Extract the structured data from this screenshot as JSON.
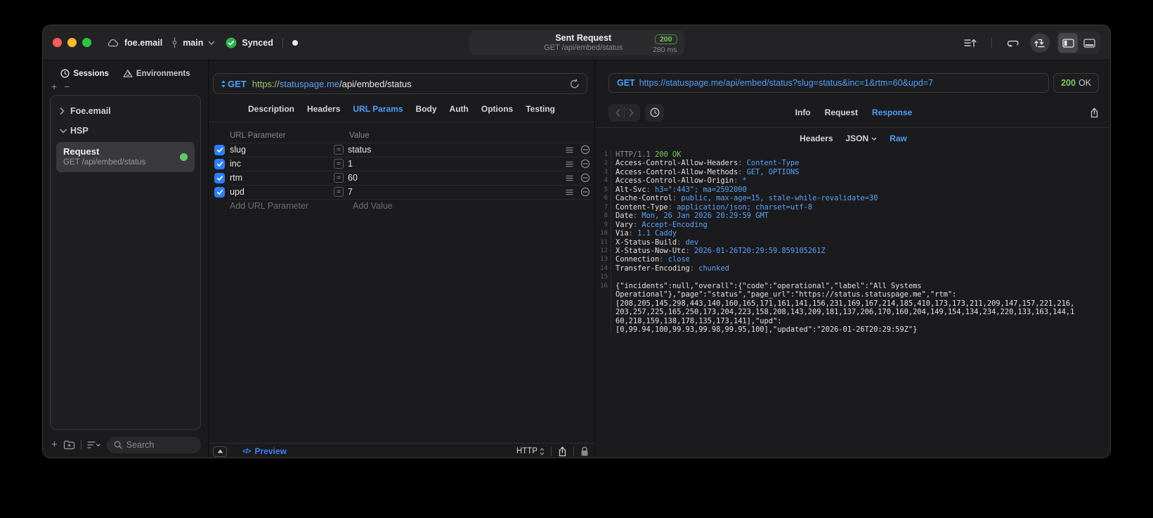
{
  "accents": {
    "blue": "#4f9df8",
    "green": "#7cc761",
    "checkbox_blue": "#2f7df6",
    "synced_green": "#2fb24c"
  },
  "titlebar": {
    "project": "foe.email",
    "branch": "main",
    "sync_status": "Synced",
    "center": {
      "title": "Sent Request",
      "subtitle": "GET /api/embed/status",
      "status_code": "200",
      "duration": "280 ms"
    }
  },
  "sidebar": {
    "tabs": [
      {
        "label": "Sessions"
      },
      {
        "label": "Environments"
      }
    ],
    "tree": [
      {
        "label": "Foe.email"
      },
      {
        "label": "HSP"
      }
    ],
    "request_item": {
      "title": "Request",
      "subtitle": "GET /api/embed/status"
    },
    "search_placeholder": "Search"
  },
  "request_editor": {
    "method": "GET",
    "url": {
      "scheme": "https://",
      "host": "statuspage.me",
      "path": "/api/embed/status"
    },
    "tabs": [
      "Description",
      "Headers",
      "URL Params",
      "Body",
      "Auth",
      "Options",
      "Testing"
    ],
    "active_tab": "URL Params",
    "param_table": {
      "col_param": "URL Parameter",
      "col_value": "Value",
      "rows": [
        {
          "name": "slug",
          "value": "status"
        },
        {
          "name": "inc",
          "value": "1"
        },
        {
          "name": "rtm",
          "value": "60"
        },
        {
          "name": "upd",
          "value": "7"
        }
      ],
      "add_param": "Add URL Parameter",
      "add_value": "Add Value"
    },
    "footer": {
      "preview": "Preview",
      "protocol": "HTTP"
    }
  },
  "response_pane": {
    "method": "GET",
    "url": "https://statuspage.me/api/embed/status?slug=status&inc=1&rtm=60&upd=7",
    "status_code": "200",
    "status_text": "OK",
    "tabs": [
      "Info",
      "Request",
      "Response"
    ],
    "active_tab": "Response",
    "subtabs": [
      "Headers",
      "JSON",
      "Raw"
    ],
    "active_subtab": "Raw",
    "body_lines": [
      {
        "num": "1",
        "segs": [
          {
            "t": "HTTP/1.1 ",
            "c": "d"
          },
          {
            "t": "200 OK",
            "c": "g"
          }
        ]
      },
      {
        "num": "2",
        "segs": [
          {
            "t": "Access-Control-Allow-Headers",
            "c": "n"
          },
          {
            "t": ": ",
            "c": "d"
          },
          {
            "t": "Content-Type",
            "c": "v"
          }
        ]
      },
      {
        "num": "3",
        "segs": [
          {
            "t": "Access-Control-Allow-Methods",
            "c": "n"
          },
          {
            "t": ": ",
            "c": "d"
          },
          {
            "t": "GET, OPTIONS",
            "c": "v"
          }
        ]
      },
      {
        "num": "4",
        "segs": [
          {
            "t": "Access-Control-Allow-Origin",
            "c": "n"
          },
          {
            "t": ": ",
            "c": "d"
          },
          {
            "t": "*",
            "c": "v"
          }
        ]
      },
      {
        "num": "5",
        "segs": [
          {
            "t": "Alt-Svc",
            "c": "n"
          },
          {
            "t": ": ",
            "c": "d"
          },
          {
            "t": "h3=\":443\"; ma=2592000",
            "c": "v"
          }
        ]
      },
      {
        "num": "6",
        "segs": [
          {
            "t": "Cache-Control",
            "c": "n"
          },
          {
            "t": ": ",
            "c": "d"
          },
          {
            "t": "public, max-age=15, stale-while-revalidate=30",
            "c": "v"
          }
        ]
      },
      {
        "num": "7",
        "segs": [
          {
            "t": "Content-Type",
            "c": "n"
          },
          {
            "t": ": ",
            "c": "d"
          },
          {
            "t": "application/json; charset=utf-8",
            "c": "v"
          }
        ]
      },
      {
        "num": "8",
        "segs": [
          {
            "t": "Date",
            "c": "n"
          },
          {
            "t": ": ",
            "c": "d"
          },
          {
            "t": "Mon, 26 Jan 2026 20:29:59 GMT",
            "c": "v"
          }
        ]
      },
      {
        "num": "9",
        "segs": [
          {
            "t": "Vary",
            "c": "n"
          },
          {
            "t": ": ",
            "c": "d"
          },
          {
            "t": "Accept-Encoding",
            "c": "v"
          }
        ]
      },
      {
        "num": "10",
        "segs": [
          {
            "t": "Via",
            "c": "n"
          },
          {
            "t": ": ",
            "c": "d"
          },
          {
            "t": "1.1 Caddy",
            "c": "v"
          }
        ]
      },
      {
        "num": "11",
        "segs": [
          {
            "t": "X-Status-Build",
            "c": "n"
          },
          {
            "t": ": ",
            "c": "d"
          },
          {
            "t": "dev",
            "c": "v"
          }
        ]
      },
      {
        "num": "12",
        "segs": [
          {
            "t": "X-Status-Now-Utc",
            "c": "n"
          },
          {
            "t": ": ",
            "c": "d"
          },
          {
            "t": "2026-01-26T20:29:59.859105261Z",
            "c": "v"
          }
        ]
      },
      {
        "num": "13",
        "segs": [
          {
            "t": "Connection",
            "c": "n"
          },
          {
            "t": ": ",
            "c": "d"
          },
          {
            "t": "close",
            "c": "v"
          }
        ]
      },
      {
        "num": "14",
        "segs": [
          {
            "t": "Transfer-Encoding",
            "c": "n"
          },
          {
            "t": ": ",
            "c": "d"
          },
          {
            "t": "chunked",
            "c": "v"
          }
        ]
      },
      {
        "num": "15",
        "segs": []
      },
      {
        "num": "16",
        "segs": [
          {
            "t": "{\"incidents\":null,\"overall\":{\"code\":\"operational\",\"label\":\"All Systems",
            "c": "n"
          }
        ]
      },
      {
        "num": "",
        "segs": [
          {
            "t": "Operational\"},\"page\":\"status\",\"page_url\":\"https://status.statuspage.me\",\"rtm\":",
            "c": "n"
          }
        ]
      },
      {
        "num": "",
        "segs": [
          {
            "t": "[208,205,145,298,443,140,160,165,171,161,141,156,231,169,167,214,185,410,173,173,211,209,147,157,221,216,",
            "c": "n"
          }
        ]
      },
      {
        "num": "",
        "segs": [
          {
            "t": "203,257,225,165,250,173,204,223,158,208,143,209,181,137,206,170,160,204,149,154,134,234,220,133,163,144,1",
            "c": "n"
          }
        ]
      },
      {
        "num": "",
        "segs": [
          {
            "t": "60,218,159,138,178,135,173,141],\"upd\":",
            "c": "n"
          }
        ]
      },
      {
        "num": "",
        "segs": [
          {
            "t": "[0,99.94,100,99.93,99.98,99.95,100],\"updated\":\"2026-01-26T20:29:59Z\"}",
            "c": "n"
          }
        ]
      }
    ]
  }
}
